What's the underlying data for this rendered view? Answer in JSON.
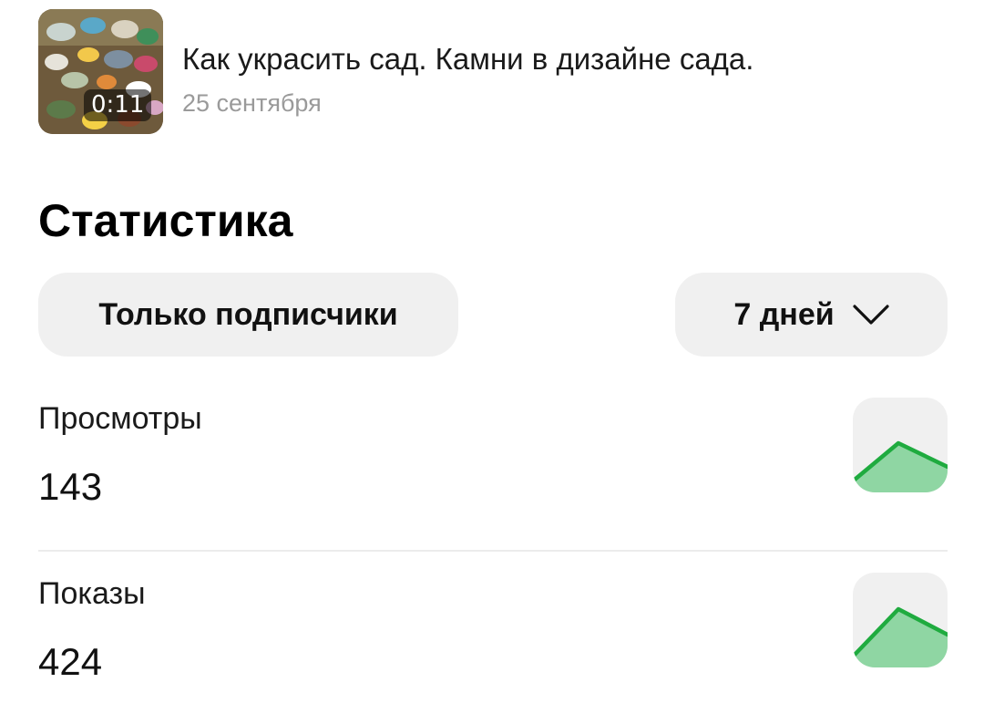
{
  "video": {
    "title": "Как украсить сад. Камни в дизайне сада.",
    "date": "25 сентября",
    "duration": "0:11",
    "thumbnail_icon": "garden-stones-thumbnail"
  },
  "statistics": {
    "heading": "Статистика",
    "filter_label": "Только подписчики",
    "period_label": "7 дней",
    "period_icon": "chevron-down-icon",
    "metrics": [
      {
        "label": "Просмотры",
        "value": "143",
        "trend_icon": "sparkline-up-icon"
      },
      {
        "label": "Показы",
        "value": "424",
        "trend_icon": "sparkline-up-icon"
      }
    ]
  },
  "colors": {
    "accent_green": "#1fab3f",
    "accent_green_fill": "#8fd6a3",
    "pill_background": "#f0f0f0",
    "date_gray": "#9a9a9a"
  }
}
